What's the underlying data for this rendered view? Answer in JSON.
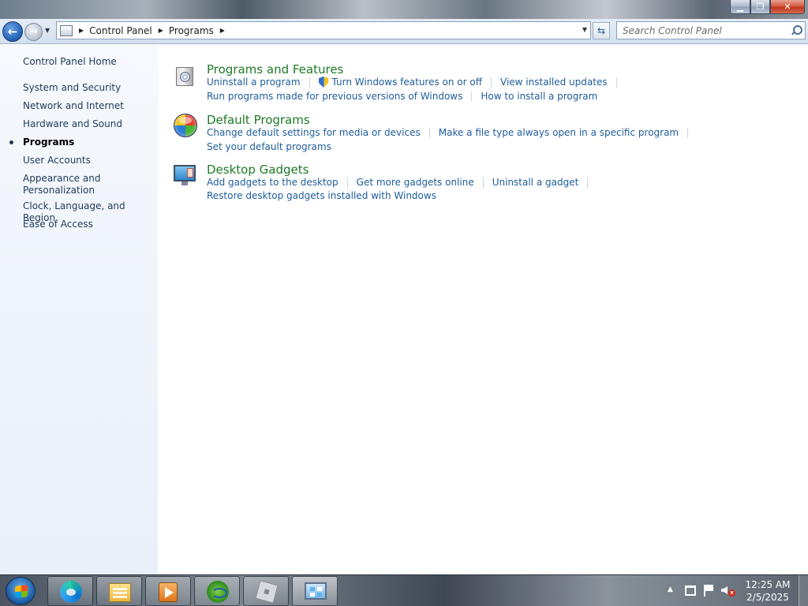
{
  "window": {
    "minimize_symbol": "▁",
    "maximize_symbol": "❐",
    "close_symbol": "✕"
  },
  "navigation": {
    "back_icon": "back-arrow-icon",
    "forward_icon": "forward-arrow-icon",
    "breadcrumb": [
      "Control Panel",
      "Programs"
    ],
    "search_placeholder": "Search Control Panel"
  },
  "sidebar": {
    "items": [
      {
        "label": "Control Panel Home",
        "current": false
      },
      {
        "label": "System and Security",
        "current": false
      },
      {
        "label": "Network and Internet",
        "current": false
      },
      {
        "label": "Hardware and Sound",
        "current": false
      },
      {
        "label": "Programs",
        "current": true
      },
      {
        "label": "User Accounts",
        "current": false
      },
      {
        "label": "Appearance and Personalization",
        "current": false
      },
      {
        "label": "Clock, Language, and Region",
        "current": false
      },
      {
        "label": "Ease of Access",
        "current": false
      }
    ]
  },
  "categories": [
    {
      "title": "Programs and Features",
      "icon": "programs-features-icon",
      "row1": [
        "Uninstall a program",
        "Turn Windows features on or off",
        "View installed updates"
      ],
      "row2": [
        "Run programs made for previous versions of Windows",
        "How to install a program"
      ]
    },
    {
      "title": "Default Programs",
      "icon": "default-programs-icon",
      "row1": [
        "Change default settings for media or devices",
        "Make a file type always open in a specific program"
      ],
      "row2": [
        "Set your default programs"
      ]
    },
    {
      "title": "Desktop Gadgets",
      "icon": "desktop-gadgets-icon",
      "row1": [
        "Add gadgets to the desktop",
        "Get more gadgets online",
        "Uninstall a gadget"
      ],
      "row2": [
        "Restore desktop gadgets installed with Windows"
      ]
    }
  ],
  "taskbar": {
    "pinned": [
      "edge-icon",
      "file-explorer-icon",
      "media-player-icon",
      "download-manager-icon",
      "roblox-icon",
      "control-panel-icon"
    ],
    "active_app": "control-panel-icon",
    "clock_time": "12:25 AM",
    "clock_date": "2/5/2025",
    "tray_arrow": "▲",
    "mute_symbol": "x"
  }
}
